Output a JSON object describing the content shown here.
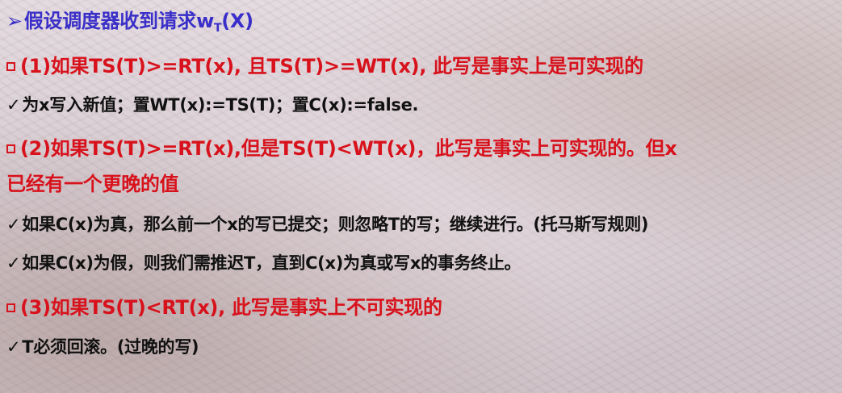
{
  "slide": {
    "heading": {
      "bullet": "➢",
      "text_before_sub": "假设调度器收到请求w",
      "subscript": "T",
      "text_after_sub": "(X)"
    },
    "items": [
      {
        "marker": "square",
        "style": "red",
        "text": "(1)如果TS(T)>=RT(x), 且TS(T)>=WT(x), 此写是事实上是可实现的"
      },
      {
        "marker": "✓",
        "style": "black",
        "text": "为x写入新值；置WT(x):=TS(T)；置C(x):=false."
      },
      {
        "marker": "square",
        "style": "red",
        "text": "(2)如果TS(T)>=RT(x),但是TS(T)<WT(x)，此写是事实上可实现的。但x"
      },
      {
        "marker": "",
        "style": "red",
        "text": "已经有一个更晚的值"
      },
      {
        "marker": "✓",
        "style": "black",
        "text": "如果C(x)为真，那么前一个x的写已提交；则忽略T的写；继续进行。(托马斯写规则)"
      },
      {
        "marker": "✓",
        "style": "black",
        "text": "如果C(x)为假，则我们需推迟T，直到C(x)为真或写x的事务终止。"
      },
      {
        "marker": "square",
        "style": "red",
        "text": "(3)如果TS(T)<RT(x), 此写是事实上不可实现的"
      },
      {
        "marker": "✓",
        "style": "black",
        "text": "T必须回滚。(过晚的写)"
      }
    ]
  },
  "colors": {
    "heading": "#3a2fc8",
    "condition": "#d8121c",
    "action": "#111111"
  }
}
